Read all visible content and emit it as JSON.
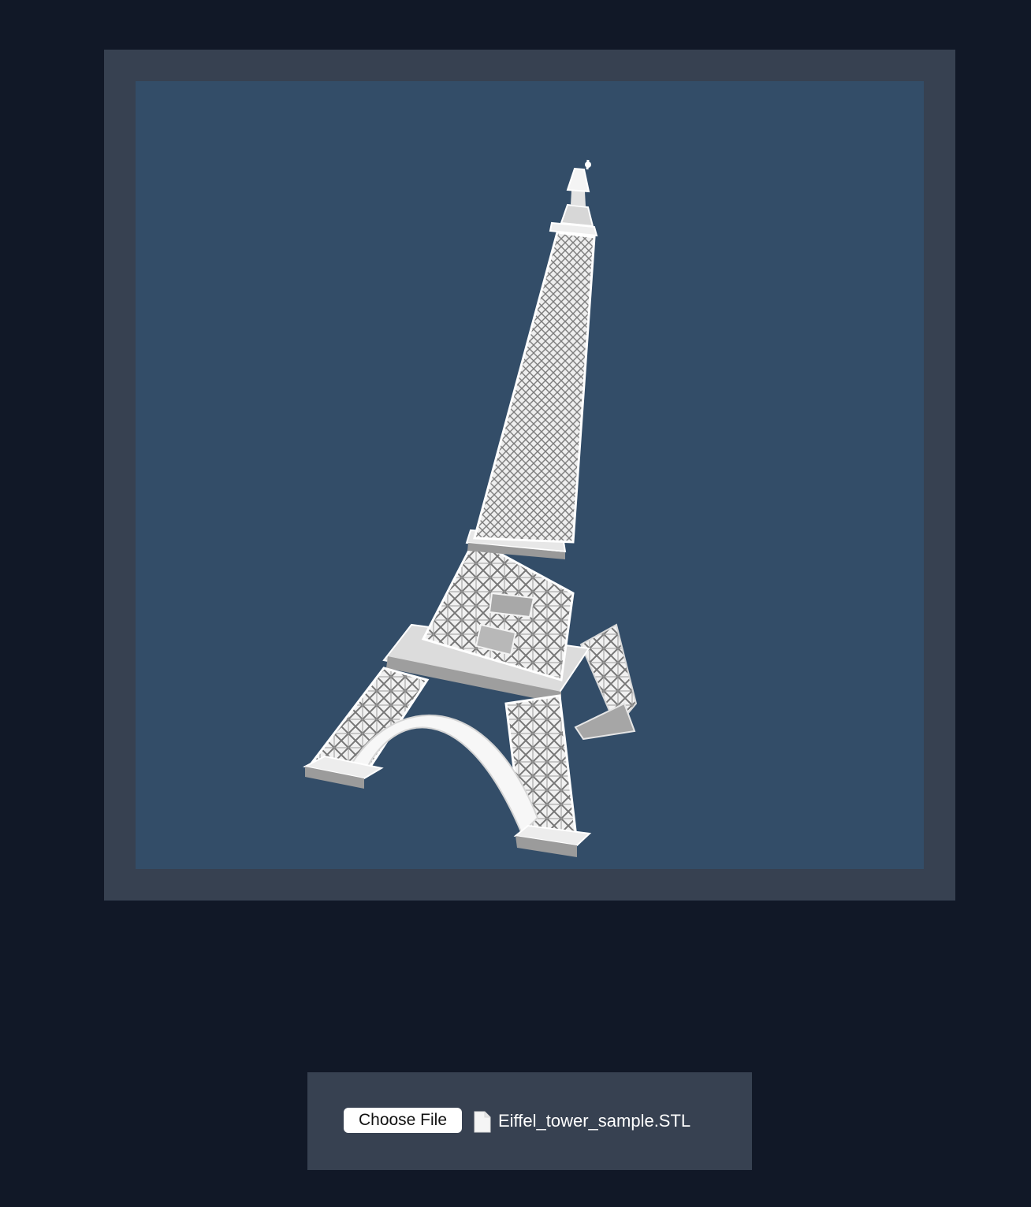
{
  "viewer": {
    "model_icon": "eiffel-tower-model",
    "colors": {
      "page_background": "#111827",
      "frame": "#374151",
      "canvas": "#334d68",
      "model": "#e5e7eb"
    }
  },
  "upload": {
    "choose_file_label": "Choose File",
    "file_icon": "document-icon",
    "file_name": "Eiffel_tower_sample.STL"
  }
}
